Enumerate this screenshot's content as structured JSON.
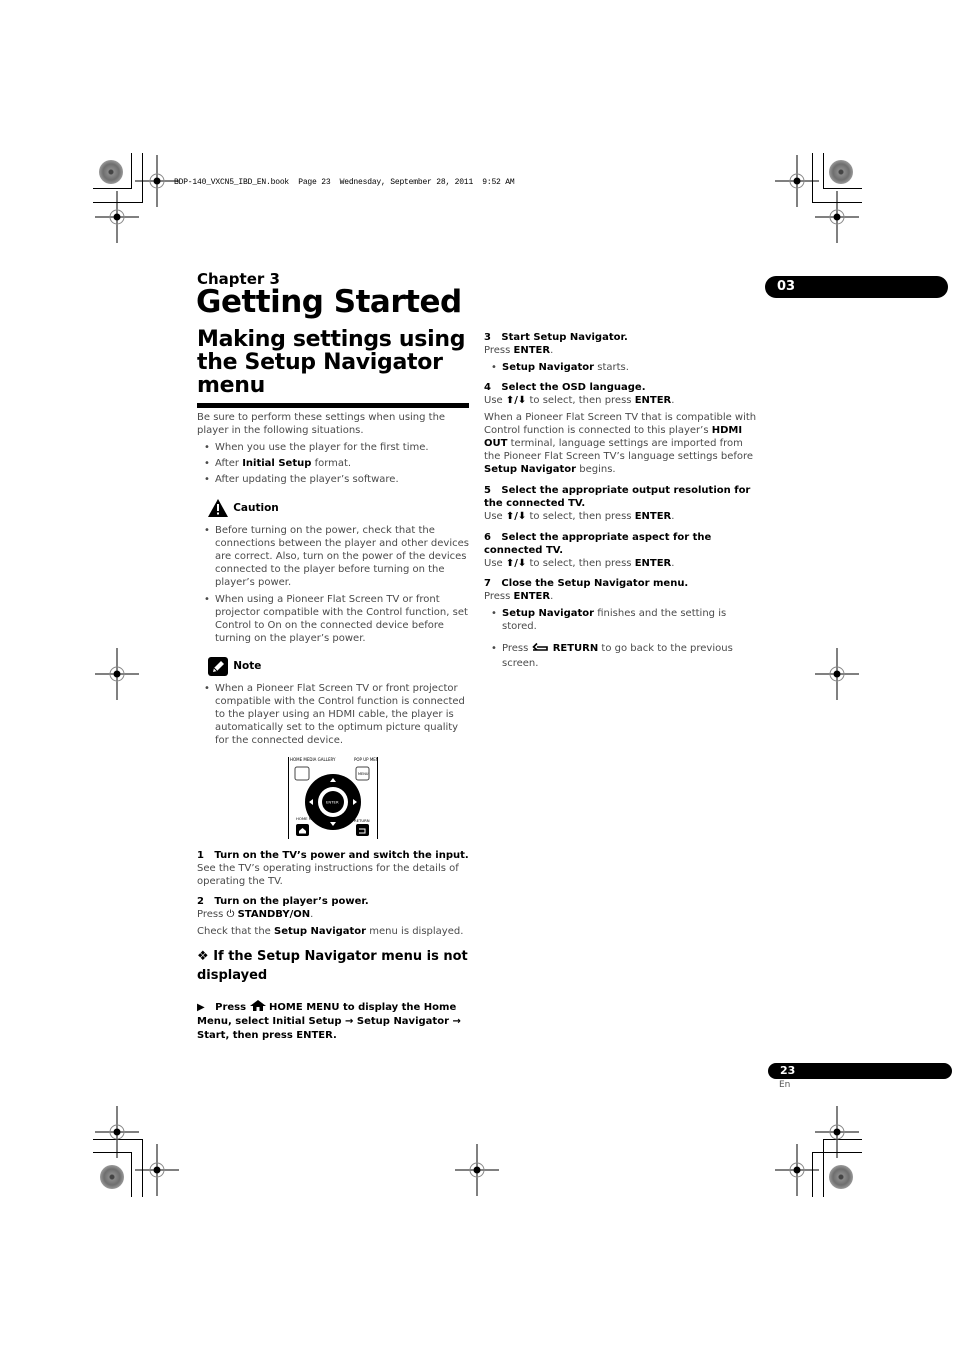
{
  "print_header": "BDP-140_VXCN5_IBD_EN.book  Page 23  Wednesday, September 28, 2011  9:52 AM",
  "chapter_label": "Chapter 3",
  "chapter_title": "Getting Started",
  "chapter_tab": "03",
  "section_title": "Making settings using the Setup Navigator menu",
  "intro": "Be sure to perform these settings when using the player in the following situations.",
  "situations": [
    {
      "text": "When you use the player for the first time."
    },
    {
      "pre": "After ",
      "bold": "Initial Setup",
      "post": " format."
    },
    {
      "text": "After updating the player’s software."
    }
  ],
  "caution": {
    "label": "Caution",
    "icon": "warning-triangle-icon",
    "items": [
      "Before turning on the power, check that the connections between the player and other devices are correct. Also, turn on the power of the devices connected to the player before turning on the player’s power.",
      "When using a Pioneer Flat Screen TV or front projector compatible with the Control function, set Control to On on the connected device before turning on the player’s power."
    ]
  },
  "note": {
    "label": "Note",
    "icon": "pencil-note-icon",
    "items": [
      "When a Pioneer Flat Screen TV or front projector compatible with the Control function is connected to the player using an HDMI cable, the player is automatically set to the optimum picture quality for the connected device."
    ]
  },
  "remote": {
    "home_media_gallery": "HOME MEDIA GALLERY",
    "popup_menu": "POP UP MENU",
    "menu_key": "MENU",
    "enter": "ENTER",
    "home_menu": "HOME MENU",
    "return": "RETURN"
  },
  "steps": [
    {
      "num": "1",
      "title": "Turn on the TV’s power and switch the input.",
      "body": "See the TV’s operating instructions for the details of operating the TV."
    },
    {
      "num": "2",
      "title": "Turn on the player’s power.",
      "press_pre": "Press ",
      "press_bold": "STANDBY/ON",
      "press_post": ".",
      "check_pre": "Check that the ",
      "check_bold": "Setup Navigator",
      "check_post": " menu is displayed."
    },
    {
      "num": "3",
      "title": "Start Setup Navigator.",
      "press_pre": "Press ",
      "press_bold": "ENTER",
      "press_post": ".",
      "bullet_bold": "Setup Navigator",
      "bullet_post": " starts."
    },
    {
      "num": "4",
      "title": "Select the OSD language.",
      "use_pre": "Use ",
      "use_mid": " to select, then press ",
      "use_bold": "ENTER",
      "use_post": ".",
      "body_a": "When a Pioneer Flat Screen TV that is compatible with Control function is connected to this player’s ",
      "body_b": "HDMI OUT",
      "body_c": " terminal, language settings are imported from the Pioneer Flat Screen TV’s language settings before ",
      "body_d": "Setup Navigator",
      "body_e": " begins."
    },
    {
      "num": "5",
      "title": "Select the appropriate output resolution for the connected TV.",
      "use_pre": "Use ",
      "use_mid": " to select, then press ",
      "use_bold": "ENTER",
      "use_post": "."
    },
    {
      "num": "6",
      "title": "Select the appropriate aspect for the connected TV.",
      "use_pre": "Use ",
      "use_mid": " to select, then press ",
      "use_bold": "ENTER",
      "use_post": "."
    },
    {
      "num": "7",
      "title": "Close the Setup Navigator menu.",
      "press_pre": "Press ",
      "press_bold": "ENTER",
      "press_post": ".",
      "b1_bold": "Setup Navigator",
      "b1_post": " finishes and the setting is stored.",
      "b2_pre": "Press ",
      "b2_bold": "RETURN",
      "b2_post": " to go back to the previous screen."
    }
  ],
  "not_displayed": {
    "heading": "If the Setup Navigator menu is not displayed",
    "instruction_a": "Press ",
    "instruction_b": " HOME MENU to display the Home Menu, select Initial Setup ",
    "instruction_c": " Setup Navigator ",
    "instruction_d": " Start, then press ENTER.",
    "arrow": "→"
  },
  "arrows_glyph": "⬆/⬇",
  "page_number": "23",
  "page_lang": "En"
}
